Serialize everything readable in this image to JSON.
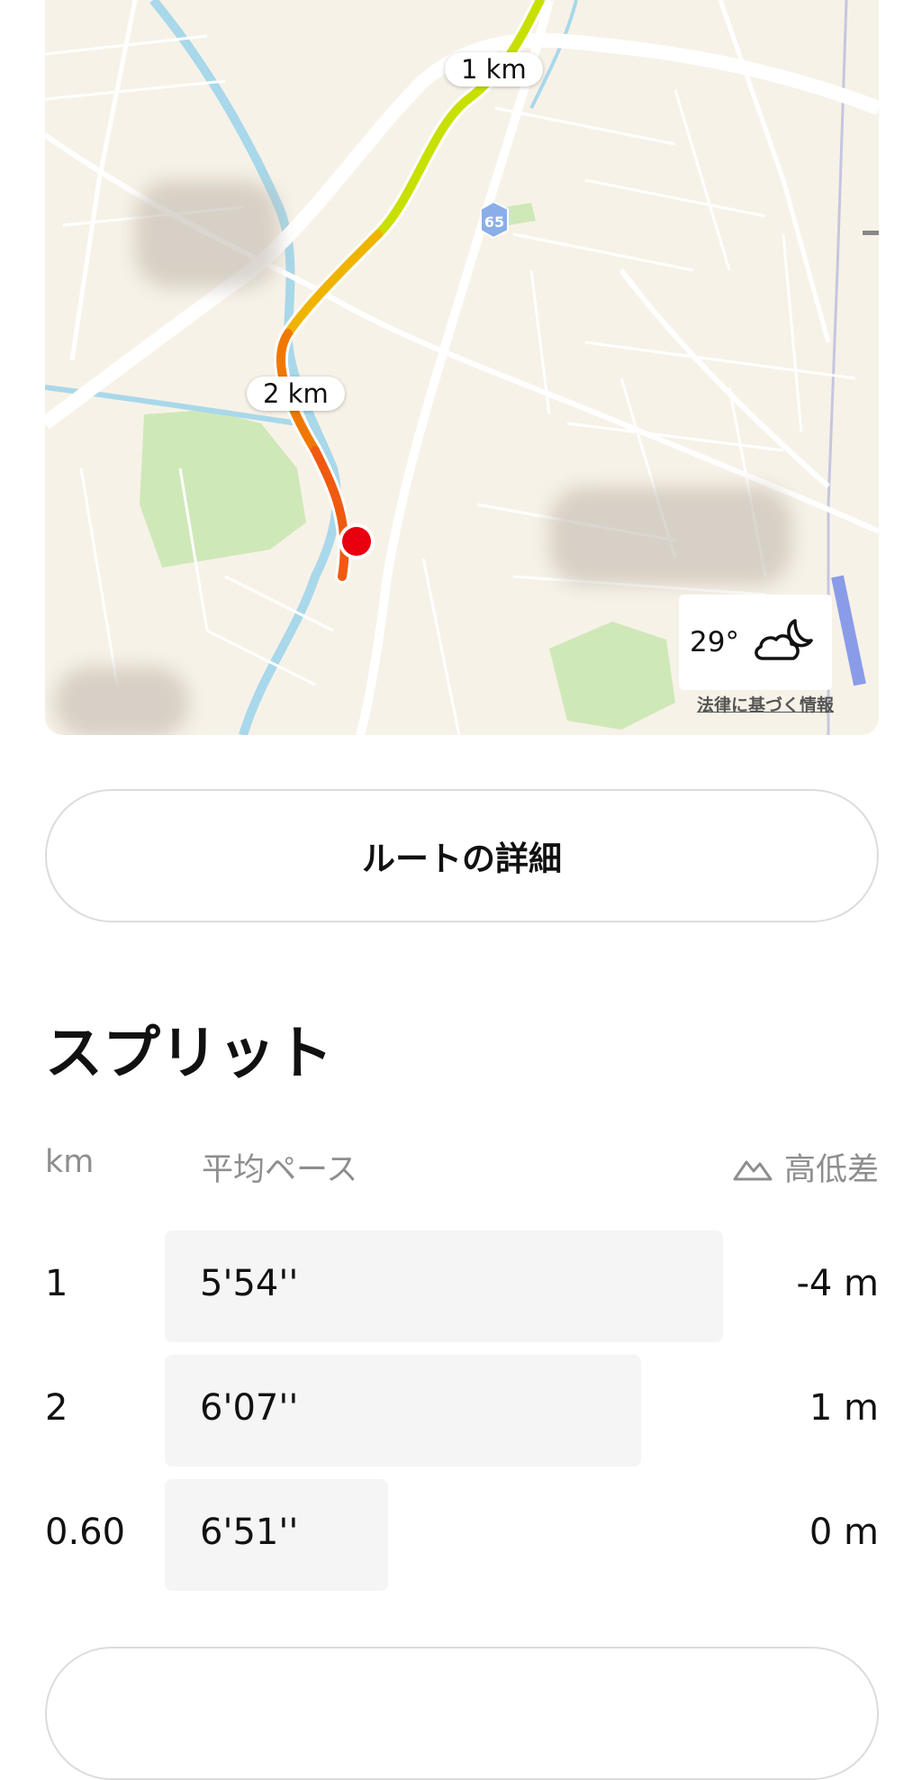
{
  "map": {
    "road_badge": "65",
    "km_markers": [
      "1 km",
      "2 km"
    ],
    "weather": {
      "temperature": "29°",
      "icon": "cloud-moon-icon"
    },
    "legal_link": "法律に基づく情報",
    "route_colors": [
      "#c8e000",
      "#f0b400",
      "#f07800",
      "#f05a10"
    ],
    "current_position_color": "#e8000f"
  },
  "route_button": {
    "label": "ルートの詳細"
  },
  "splits": {
    "title": "スプリット",
    "headers": {
      "km": "km",
      "pace": "平均ペース",
      "elevation": "高低差"
    },
    "rows": [
      {
        "km": "1",
        "pace": "5'54''",
        "elevation": "-4 m",
        "pace_bar_fraction": 1.0
      },
      {
        "km": "2",
        "pace": "6'07''",
        "elevation": "1 m",
        "pace_bar_fraction": 0.853
      },
      {
        "km": "0.60",
        "pace": "6'51''",
        "elevation": "0 m",
        "pace_bar_fraction": 0.4
      }
    ]
  }
}
